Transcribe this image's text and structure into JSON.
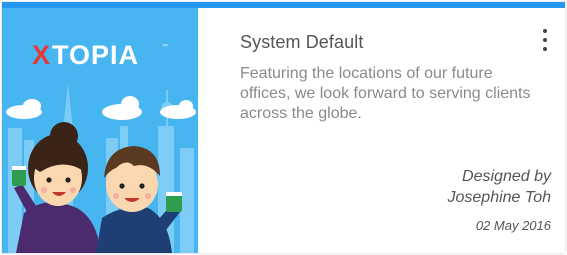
{
  "card": {
    "brand_logo": "XTOPIA",
    "brand_logo_mark": "™",
    "title": "System Default",
    "description": "Featuring the locations of our future offices, we look forward to serving clients across the globe.",
    "designed_by_label": "Designed by",
    "designer": "Josephine Toh",
    "date": "02 May 2016",
    "menu_icon": "more-vertical-icon",
    "colors": {
      "accent": "#2196f3",
      "thumbnail_bg": "#47b5f0",
      "logo_x": "#e53935"
    }
  }
}
